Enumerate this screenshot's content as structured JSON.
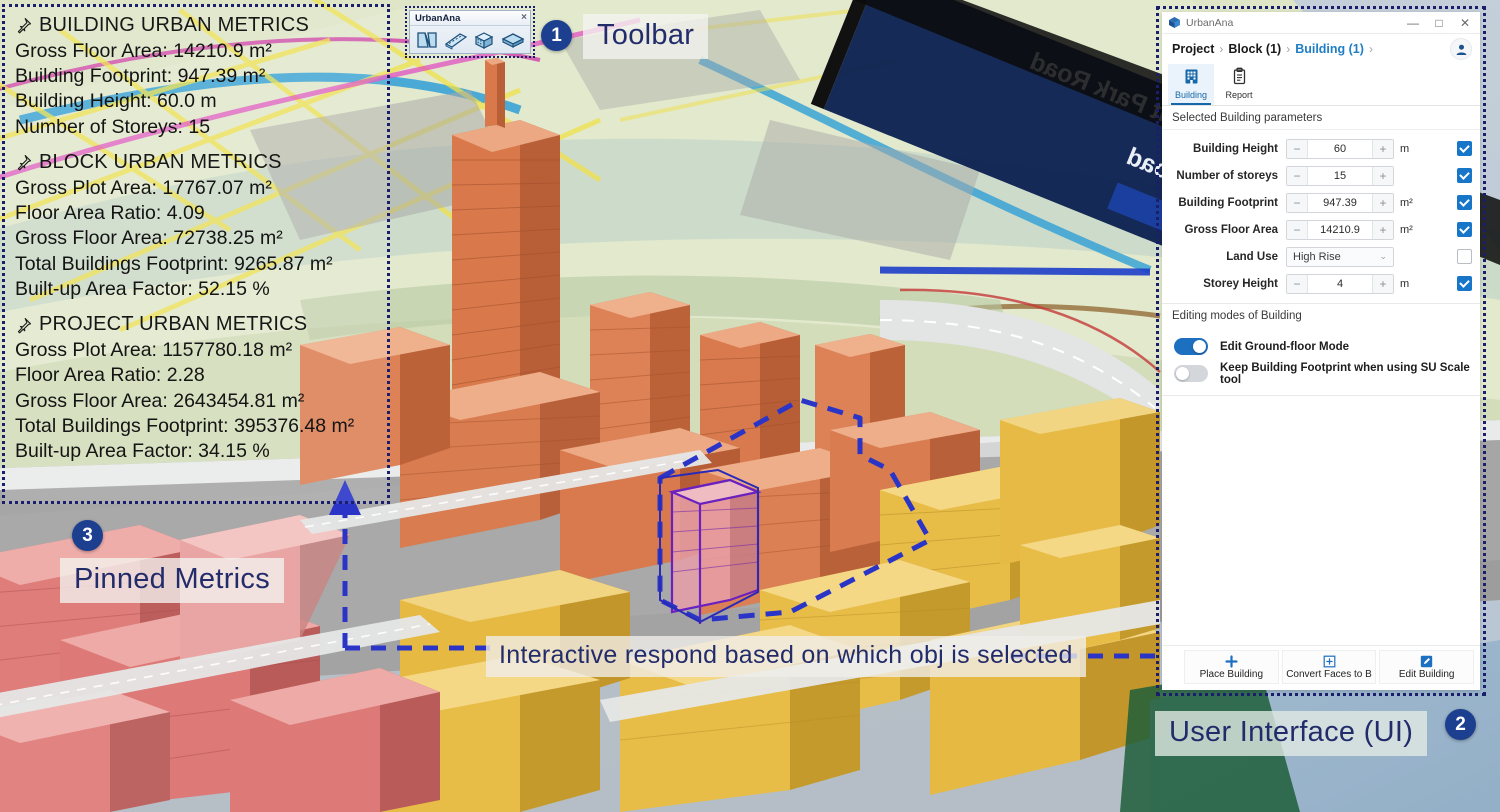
{
  "toolbar": {
    "title": "UrbanAna",
    "close_label": "×",
    "buttons": [
      {
        "name": "plot-tool",
        "label": "Plot"
      },
      {
        "name": "road-tool",
        "label": "Road"
      },
      {
        "name": "building-tool",
        "label": "Building"
      },
      {
        "name": "slab-tool",
        "label": "Slab"
      }
    ]
  },
  "pinned_metrics": {
    "groups": [
      {
        "title": "BUILDING URBAN METRICS",
        "lines": [
          "Gross Floor Area: 14210.9 m²",
          "Building Footprint: 947.39 m²",
          "Building Height: 60.0 m",
          "Number of Storeys: 15"
        ]
      },
      {
        "title": "BLOCK URBAN METRICS",
        "lines": [
          "Gross Plot Area: 17767.07 m²",
          "Floor Area Ratio: 4.09",
          "Gross Floor Area: 72738.25 m²",
          "Total Buildings Footprint: 9265.87 m²",
          "Built-up Area Factor: 52.15 %"
        ]
      },
      {
        "title": "PROJECT URBAN METRICS",
        "lines": [
          "Gross Plot Area: 1157780.18 m²",
          "Floor Area Ratio: 2.28",
          "Gross Floor Area: 2643454.81 m²",
          "Total Buildings Footprint: 395376.48 m²",
          "Built-up Area Factor: 34.15 %"
        ]
      }
    ]
  },
  "annotations": {
    "toolbar": {
      "badge": "1",
      "label": "Toolbar"
    },
    "ui": {
      "badge": "2",
      "label": "User Interface (UI)"
    },
    "pinned": {
      "badge": "3",
      "label": "Pinned Metrics"
    },
    "interactive_note": "Interactive respond based on which obj is selected"
  },
  "ui_panel": {
    "app_title": "UrbanAna",
    "window_controls": {
      "minimize": "—",
      "maximize": "□",
      "close": "✕"
    },
    "breadcrumb": [
      {
        "label": "Project",
        "active": false
      },
      {
        "label": "Block (1)",
        "active": false
      },
      {
        "label": "Building (1)",
        "active": true
      }
    ],
    "breadcrumb_separator": "›",
    "tabs": [
      {
        "label": "Building",
        "icon": "building-icon",
        "active": true
      },
      {
        "label": "Report",
        "icon": "clipboard-icon",
        "active": false
      }
    ],
    "parameters_section_title": "Selected Building parameters",
    "parameters": [
      {
        "label": "Building Height",
        "type": "stepper",
        "value": "60",
        "unit": "m",
        "checked": true,
        "minus": "−",
        "plus": "+"
      },
      {
        "label": "Number of storeys",
        "type": "stepper",
        "value": "15",
        "unit": "",
        "checked": true,
        "minus": "−",
        "plus": "+"
      },
      {
        "label": "Building Footprint",
        "type": "stepper",
        "value": "947.39",
        "unit": "m²",
        "checked": true,
        "minus": "−",
        "plus": "+"
      },
      {
        "label": "Gross Floor Area",
        "type": "stepper",
        "value": "14210.9",
        "unit": "m²",
        "checked": true,
        "minus": "−",
        "plus": "+"
      },
      {
        "label": "Land Use",
        "type": "select",
        "value": "High Rise",
        "unit": "",
        "checked": false,
        "chevron": "⌄"
      },
      {
        "label": "Storey Height",
        "type": "stepper",
        "value": "4",
        "unit": "m",
        "checked": true,
        "minus": "−",
        "plus": "+"
      }
    ],
    "editing_section_title": "Editing modes of Building",
    "toggles": [
      {
        "label": "Edit Ground-floor Mode",
        "on": true
      },
      {
        "label": "Keep Building Footprint when using SU Scale tool",
        "on": false
      }
    ],
    "bottom_buttons": [
      {
        "label": "Place Building",
        "icon": "plus-icon"
      },
      {
        "label": "Convert Faces to B",
        "icon": "grid-plus-icon"
      },
      {
        "label": "Edit Building",
        "icon": "pencil-icon"
      }
    ]
  },
  "scene": {
    "street_sign": {
      "line1": "Waterfront Park Road",
      "line2": "Delta Road"
    },
    "colors": {
      "building_orange": "#e08a5d",
      "building_yellow": "#e8b93c",
      "building_red": "#de7b79",
      "selection_blue": "#2a35c8",
      "road_grey": "#9b9b9b",
      "ground_green": "#d7e0bc"
    }
  }
}
